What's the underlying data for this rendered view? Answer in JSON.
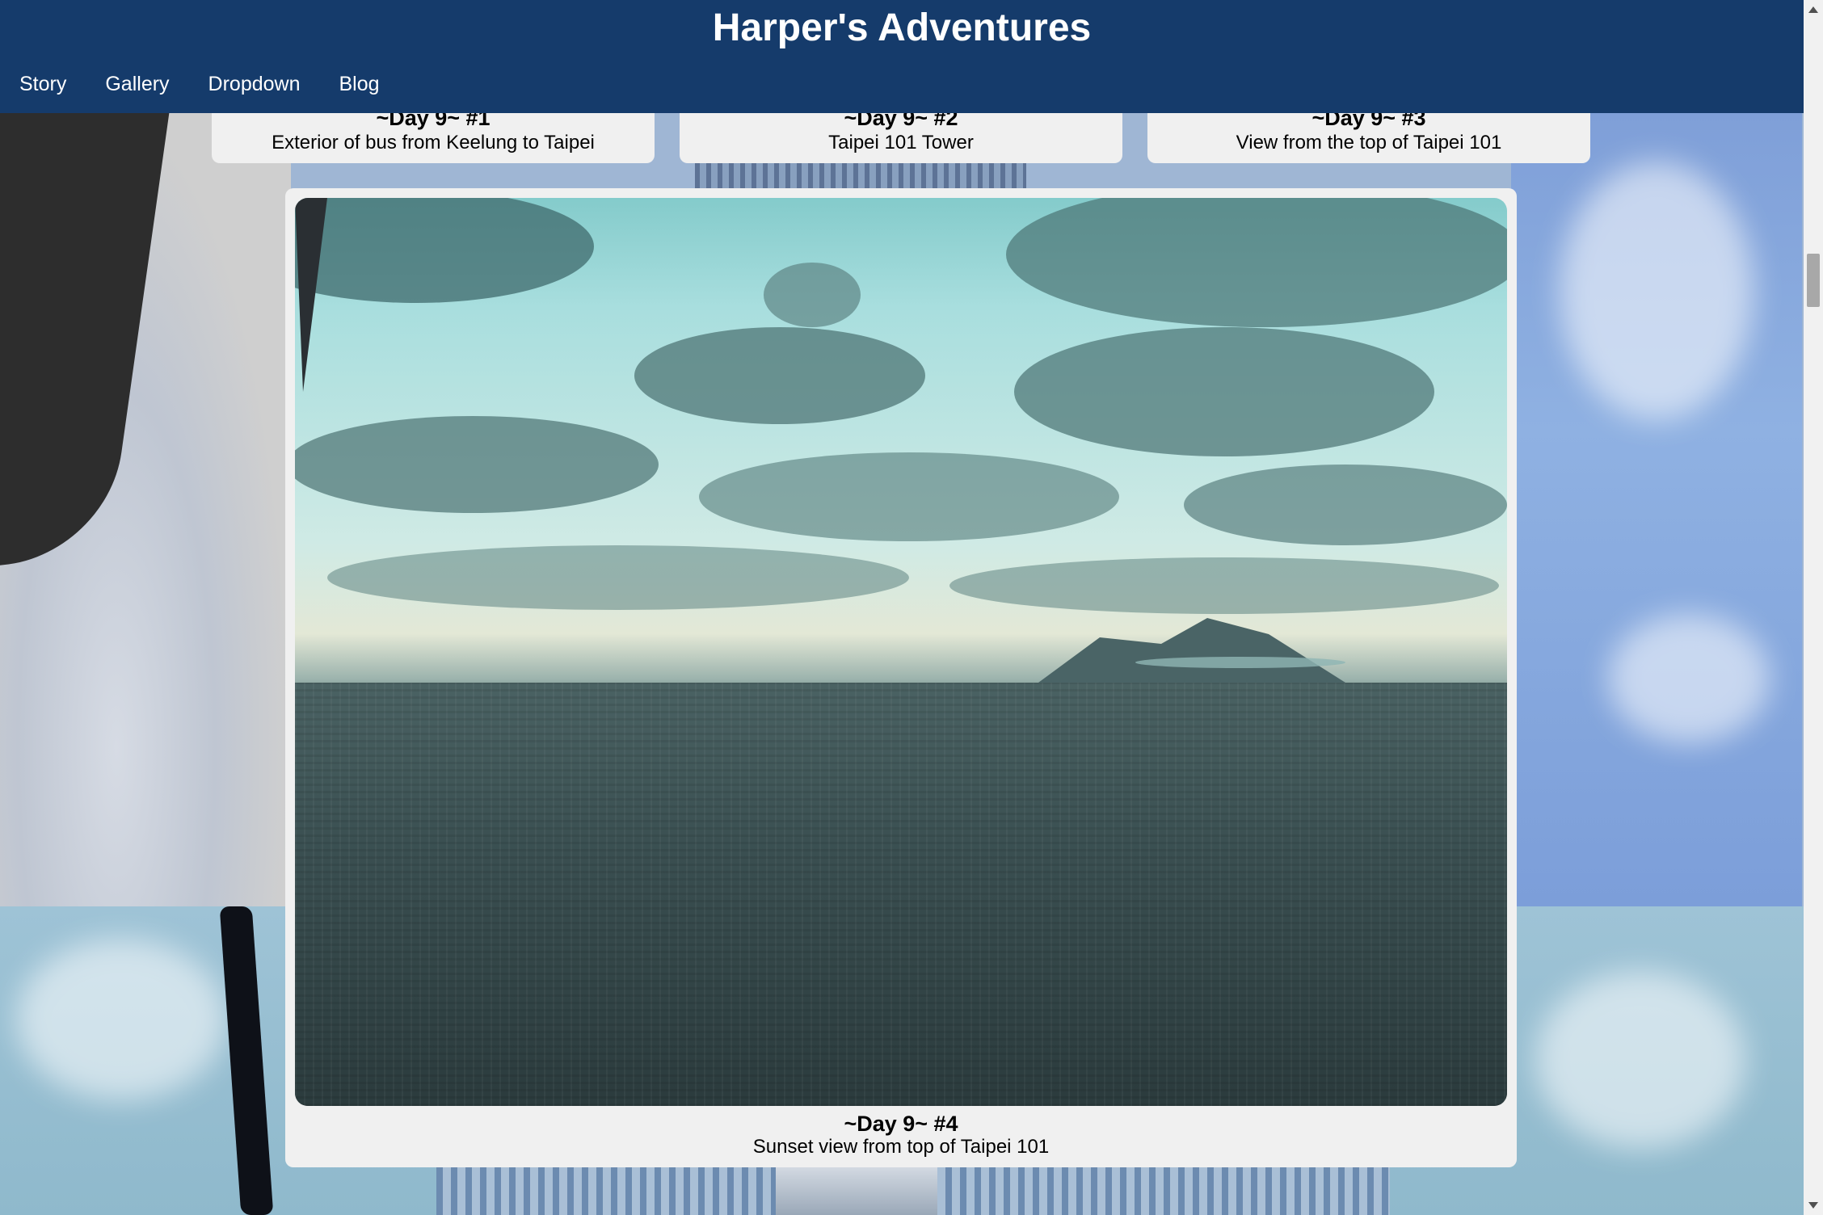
{
  "header": {
    "site_title": "Harper's Adventures",
    "nav": [
      "Story",
      "Gallery",
      "Dropdown",
      "Blog"
    ]
  },
  "gallery": {
    "cards": [
      {
        "title": "~Day 9~ #1",
        "caption": "Exterior of bus from Keelung to Taipei"
      },
      {
        "title": "~Day 9~ #2",
        "caption": "Taipei 101 Tower"
      },
      {
        "title": "~Day 9~ #3",
        "caption": "View from the top of Taipei 101"
      },
      {
        "title": "~Day 9~ #4",
        "caption": "Sunset view from top of Taipei 101"
      }
    ]
  },
  "colors": {
    "header_bg": "#153b6b",
    "card_bg": "#f0f0f0"
  }
}
